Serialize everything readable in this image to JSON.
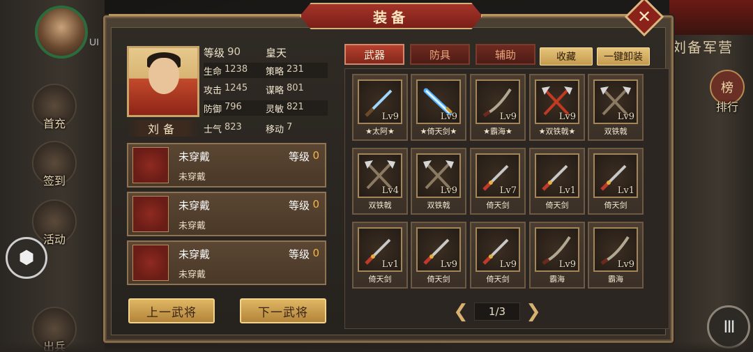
{
  "window": {
    "title": "装备",
    "close_symbol": "✕"
  },
  "background": {
    "camp_title": "刘备军营",
    "player_tag": "UI",
    "side_buttons": [
      {
        "label": "首充",
        "icon": "gift-icon"
      },
      {
        "label": "签到",
        "icon": "calendar-icon"
      },
      {
        "label": "活动",
        "icon": "drum-icon"
      },
      {
        "label": "出兵",
        "icon": "flag-icon"
      }
    ],
    "rank_label": "排行",
    "rank_symbol": "榜",
    "cube_symbol": "⬢",
    "menu_symbol": "III"
  },
  "hero": {
    "name": "刘备",
    "stats": [
      {
        "key": "等级",
        "val": "90",
        "key2": "皇天",
        "val2": ""
      },
      {
        "key": "生命",
        "val": "1238",
        "key2": "策略",
        "val2": "231"
      },
      {
        "key": "攻击",
        "val": "1245",
        "key2": "谋略",
        "val2": "801"
      },
      {
        "key": "防御",
        "val": "796",
        "key2": "灵敏",
        "val2": "821"
      },
      {
        "key": "士气",
        "val": "823",
        "key2": "移动",
        "val2": "7"
      }
    ]
  },
  "equip_slots": [
    {
      "title": "未穿戴",
      "level_label": "等级",
      "level": "0",
      "sub": "未穿戴"
    },
    {
      "title": "未穿戴",
      "level_label": "等级",
      "level": "0",
      "sub": "未穿戴"
    },
    {
      "title": "未穿戴",
      "level_label": "等级",
      "level": "0",
      "sub": "未穿戴"
    }
  ],
  "hero_nav": {
    "prev": "上一武将",
    "next": "下一武将"
  },
  "tabs": [
    {
      "label": "武器",
      "active": true
    },
    {
      "label": "防具",
      "active": false
    },
    {
      "label": "辅助",
      "active": false
    }
  ],
  "actions": {
    "collect": "收藏",
    "unequip_all": "一键卸装"
  },
  "items": [
    {
      "name": "★太阿★",
      "lv": "Lv9",
      "kind": "sword-blue"
    },
    {
      "name": "★倚天剑★",
      "lv": "Lv9",
      "kind": "sword-glow"
    },
    {
      "name": "★霸海★",
      "lv": "Lv9",
      "kind": "sword-curved"
    },
    {
      "name": "★双铁戟★",
      "lv": "Lv9",
      "kind": "halberd-red"
    },
    {
      "name": "双铁戟",
      "lv": "Lv9",
      "kind": "halberd"
    },
    {
      "name": "双铁戟",
      "lv": "Lv4",
      "kind": "halberd"
    },
    {
      "name": "双铁戟",
      "lv": "Lv9",
      "kind": "halberd"
    },
    {
      "name": "倚天剑",
      "lv": "Lv7",
      "kind": "dagger"
    },
    {
      "name": "倚天剑",
      "lv": "Lv1",
      "kind": "dagger"
    },
    {
      "name": "倚天剑",
      "lv": "Lv1",
      "kind": "dagger"
    },
    {
      "name": "倚天剑",
      "lv": "Lv1",
      "kind": "dagger"
    },
    {
      "name": "倚天剑",
      "lv": "Lv9",
      "kind": "dagger"
    },
    {
      "name": "倚天剑",
      "lv": "Lv9",
      "kind": "dagger"
    },
    {
      "name": "霸海",
      "lv": "Lv9",
      "kind": "sword-curved"
    },
    {
      "name": "霸海",
      "lv": "Lv9",
      "kind": "sword-curved"
    }
  ],
  "pager": {
    "text": "1/3",
    "prev_symbol": "❮",
    "next_symbol": "❯"
  },
  "colors": {
    "accent_gold": "#c9a25a",
    "tab_active": "#b8402e",
    "level_orange": "#f4b54a"
  }
}
